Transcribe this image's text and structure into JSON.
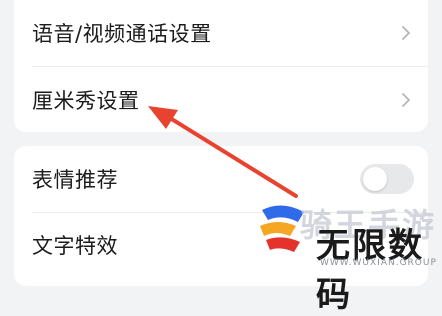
{
  "settings_group_1": {
    "items": [
      {
        "label": "语音/视频通话设置",
        "icon": "chevron-right-icon"
      },
      {
        "label": "厘米秀设置",
        "icon": "chevron-right-icon"
      }
    ]
  },
  "settings_group_2": {
    "items": [
      {
        "label": "表情推荐",
        "control": "toggle",
        "toggle_on": false
      },
      {
        "label": "文字特效"
      }
    ]
  },
  "annotation": {
    "arrow_color": "#e8432f",
    "points_to": "厘米秀设置"
  },
  "watermark": {
    "brand_grey": "骑王手游",
    "brand_main": "无限数码",
    "url": "WWW.WUXIAN.GROUP",
    "colors": {
      "accent_blue": "#2f6be8",
      "accent_orange": "#f5a623",
      "accent_red": "#e5322d"
    }
  },
  "colors": {
    "background": "#f2f3f5",
    "card": "#ffffff",
    "text": "#1c1c1c",
    "chevron": "#b5b5b5"
  }
}
